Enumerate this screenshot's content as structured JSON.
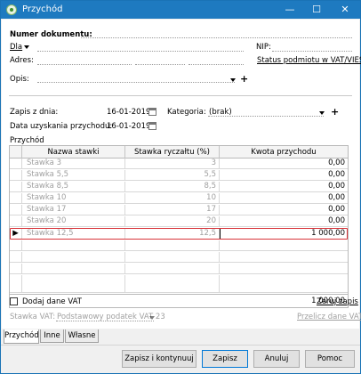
{
  "window": {
    "title": "Przychód"
  },
  "form": {
    "doc_number_label": "Numer dokumentu:",
    "dla_label": "Dla",
    "nip_label": "NIP:",
    "adres_label": "Adres:",
    "vat_status_link": "Status podmiotu w VAT/VIES",
    "opis_label": "Opis:",
    "zapis_label": "Zapis z dnia:",
    "zapis_date": "16-01-2019",
    "kategoria_label": "Kategoria:",
    "kategoria_value": "(brak)",
    "uzyskania_label": "Data uzyskania przychodu:",
    "uzyskania_date": "16-01-2019",
    "przychod_label": "Przychód"
  },
  "table": {
    "columns": [
      "Nazwa stawki",
      "Stawka ryczałtu (%)",
      "Kwota przychodu"
    ],
    "rows": [
      {
        "name": "Stawka 3",
        "rate": "3",
        "amount": "0,00"
      },
      {
        "name": "Stawka 5,5",
        "rate": "5,5",
        "amount": "0,00"
      },
      {
        "name": "Stawka 8,5",
        "rate": "8,5",
        "amount": "0,00"
      },
      {
        "name": "Stawka 10",
        "rate": "10",
        "amount": "0,00"
      },
      {
        "name": "Stawka 17",
        "rate": "17",
        "amount": "0,00"
      },
      {
        "name": "Stawka 20",
        "rate": "20",
        "amount": "0,00"
      },
      {
        "name": "Stawka 12,5",
        "rate": "12,5",
        "amount": "1 000,00"
      }
    ],
    "total": "1 000,00"
  },
  "vat": {
    "add_vat_label": "Dodaj dane VAT",
    "zeruj_link": "Zeruj zapis",
    "stawka_vat_label": "Stawka VAT:",
    "stawka_vat_value": "Podstawowy podatek VAT 23",
    "przelicz_link": "Przelicz dane VAT"
  },
  "tabs": [
    "Przychód",
    "Inne",
    "Własne"
  ],
  "buttons": {
    "save_continue": "Zapisz i kontynuuj",
    "save": "Zapisz",
    "cancel": "Anuluj",
    "help": "Pomoc"
  },
  "colors": {
    "titlebar": "#1e7ac0",
    "selection_border": "#d8343a"
  }
}
